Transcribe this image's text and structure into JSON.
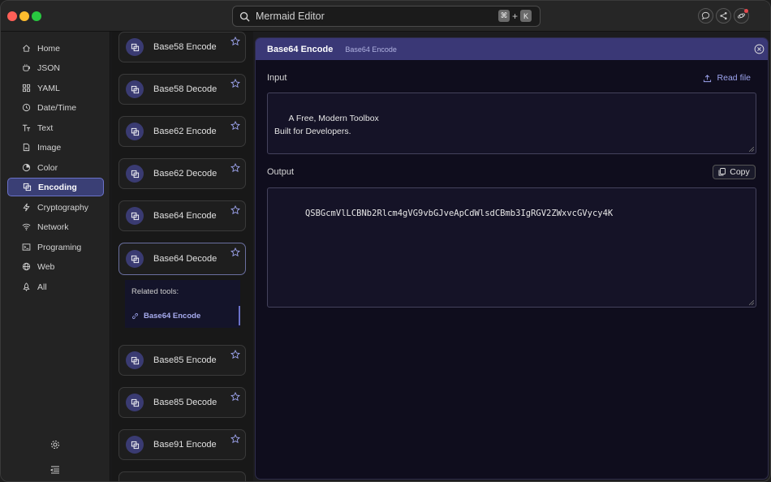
{
  "search": {
    "placeholder": "Mermaid Editor",
    "key1": "⌘",
    "plus": "+",
    "key2": "K"
  },
  "sidebar": {
    "items": [
      {
        "label": "Home",
        "icon": "home-icon"
      },
      {
        "label": "JSON",
        "icon": "json-icon"
      },
      {
        "label": "YAML",
        "icon": "yaml-icon"
      },
      {
        "label": "Date/Time",
        "icon": "clock-icon"
      },
      {
        "label": "Text",
        "icon": "text-icon"
      },
      {
        "label": "Image",
        "icon": "image-icon"
      },
      {
        "label": "Color",
        "icon": "color-icon"
      },
      {
        "label": "Encoding",
        "icon": "encoding-icon",
        "active": true
      },
      {
        "label": "Cryptography",
        "icon": "bolt-icon"
      },
      {
        "label": "Network",
        "icon": "wifi-icon"
      },
      {
        "label": "Programing",
        "icon": "terminal-icon"
      },
      {
        "label": "Web",
        "icon": "globe-icon"
      },
      {
        "label": "All",
        "icon": "rocket-icon"
      }
    ]
  },
  "tools": {
    "cards": [
      {
        "label": "Base58 Encode"
      },
      {
        "label": "Base58 Decode"
      },
      {
        "label": "Base62 Encode"
      },
      {
        "label": "Base62 Decode"
      },
      {
        "label": "Base64 Encode"
      },
      {
        "label": "Base64 Decode",
        "active": true
      },
      {
        "label": "Base85 Encode"
      },
      {
        "label": "Base85 Decode"
      },
      {
        "label": "Base91 Encode"
      }
    ],
    "related_title": "Related tools:",
    "related_item": "Base64 Encode"
  },
  "panel": {
    "title": "Base64 Encode",
    "subtitle": "Base64 Encode",
    "input_label": "Input",
    "read_file": "Read file",
    "input_value": "A Free, Modern Toolbox\nBuilt for Developers.",
    "output_label": "Output",
    "copy_label": "Copy",
    "output_value": "QSBGcmVlLCBNb2Rlcm4gVG9vbGJveApCdWlsdCBmb3IgRGV2ZWxvcGVycy4K"
  },
  "colors": {
    "accent": "#3a3876",
    "active_nav": "#3a3f75",
    "link": "#9da4ee"
  }
}
